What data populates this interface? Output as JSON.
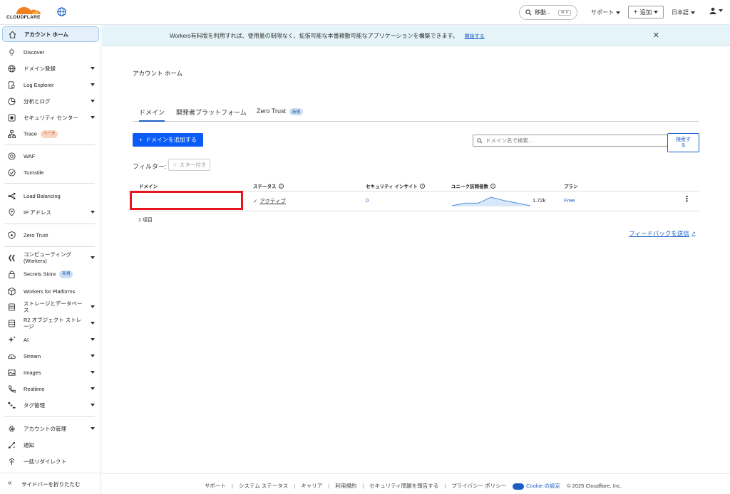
{
  "brand": {
    "name": "CLOUDFLARE",
    "accent": "#f38020",
    "link_color": "#1b5fc4"
  },
  "topbar": {
    "search_label": "移動...",
    "search_shortcut": "⌘ K",
    "support_label": "サポート",
    "add_label": "追加",
    "language_label": "日本語"
  },
  "sidebar": {
    "items": [
      {
        "label": "アカウント ホーム",
        "icon": "home-icon"
      },
      {
        "label": "Discover",
        "icon": "lightbulb-icon"
      },
      {
        "label": "ドメイン登録",
        "icon": "globe-icon"
      },
      {
        "label": "Log Explorer",
        "icon": "document-search-icon"
      },
      {
        "label": "分析とログ",
        "icon": "clock-chart-icon"
      },
      {
        "label": "セキュリティ センター",
        "icon": "security-center-icon"
      },
      {
        "label": "Trace",
        "icon": "hierarchy-icon",
        "badge": "ベータ"
      },
      {
        "label": "WAF",
        "icon": "waf-icon"
      },
      {
        "label": "Turnstile",
        "icon": "turnstile-icon"
      },
      {
        "label": "Load Balancing",
        "icon": "load-balancing-icon"
      },
      {
        "label": "IP アドレス",
        "icon": "location-pin-icon"
      },
      {
        "label": "Zero Trust",
        "icon": "zero-trust-icon"
      },
      {
        "label": "コンピューティング (Workers)",
        "icon": "workers-icon"
      },
      {
        "label": "Secrets Store",
        "icon": "lock-icon",
        "badge": "新規"
      },
      {
        "label": "Workers for Platforms",
        "icon": "cube-icon"
      },
      {
        "label": "ストレージとデータベース",
        "icon": "database-icon"
      },
      {
        "label": "R2 オブジェクト ストレージ",
        "icon": "storage-icon"
      },
      {
        "label": "AI",
        "icon": "ai-sparkle-icon"
      },
      {
        "label": "Stream",
        "icon": "cloud-play-icon"
      },
      {
        "label": "Images",
        "icon": "image-icon"
      },
      {
        "label": "Realtime",
        "icon": "phone-icon"
      },
      {
        "label": "タグ管理",
        "icon": "tag-management-icon"
      },
      {
        "label": "アカウントの管理",
        "icon": "gear-icon"
      },
      {
        "label": "通知",
        "icon": "notification-icon"
      },
      {
        "label": "一括リダイレクト",
        "icon": "redirect-icon"
      }
    ],
    "collapse_label": "サイドバーを折りたたむ"
  },
  "banner": {
    "text": "Workers有料版を利用すれば、使用量の制限なく、拡張可能な本番稼動可能なアプリケーションを構築できます。",
    "link": "開始する"
  },
  "main": {
    "title": "アカウント ホーム",
    "tabs": [
      {
        "label": "ドメイン"
      },
      {
        "label": "開発者プラットフォーム"
      },
      {
        "label": "Zero Trust",
        "badge": "新規"
      }
    ],
    "add_domain_label": "ドメインを追加する",
    "search_placeholder": "ドメイン名で検索...",
    "search_button": "検索する",
    "filter_label": "フィルター:",
    "starred_chip": "スター付き",
    "table": {
      "headers": [
        "ドメイン",
        "ステータス",
        "セキュリティ インサイト",
        "ユニーク訪問者数",
        "プラン"
      ],
      "rows": [
        {
          "domain": "",
          "status": "アクティブ",
          "insights": "0",
          "visitors": "1.72k",
          "visitors_trend": [
            0,
            0.3,
            0.3,
            1,
            0.6,
            0.3,
            0
          ],
          "plan": "Free"
        }
      ]
    },
    "item_count": "1 項目",
    "feedback": "フィードバックを送信"
  },
  "footer": {
    "links": [
      "サポート",
      "システム ステータス",
      "キャリア",
      "利用規約",
      "セキュリティ問題を報告する",
      "プライバシー ポリシー"
    ],
    "cookie": "Cookie の設定",
    "copyright": "© 2025 Cloudflare, Inc."
  }
}
